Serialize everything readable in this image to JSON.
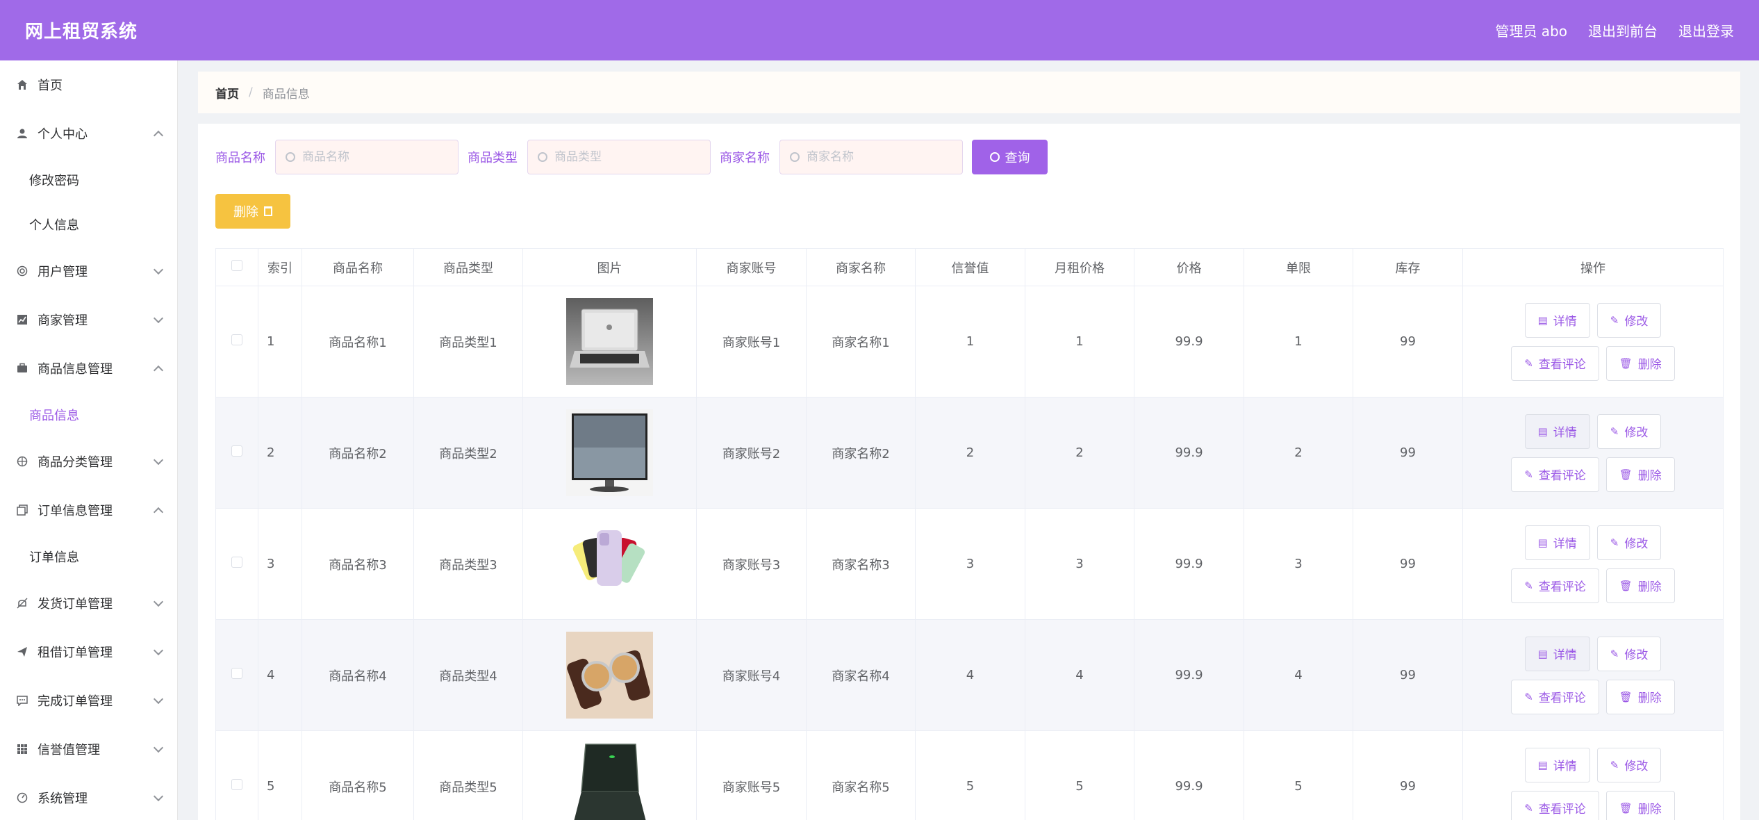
{
  "app": {
    "title": "网上租贸系统"
  },
  "header": {
    "user": "管理员 abo",
    "front": "退出到前台",
    "logout": "退出登录"
  },
  "sidebar": {
    "items": [
      {
        "label": "首页",
        "icon": "home-icon"
      },
      {
        "label": "个人中心",
        "icon": "user-icon",
        "sub": [
          "修改密码",
          "个人信息"
        ]
      },
      {
        "label": "用户管理",
        "icon": "users-icon"
      },
      {
        "label": "商家管理",
        "icon": "chart-icon"
      },
      {
        "label": "商品信息管理",
        "icon": "briefcase-icon",
        "sub": [
          "商品信息"
        ]
      },
      {
        "label": "商品分类管理",
        "icon": "compass-icon"
      },
      {
        "label": "订单信息管理",
        "icon": "copy-icon",
        "sub": [
          "订单信息"
        ]
      },
      {
        "label": "发货订单管理",
        "icon": "bell-icon"
      },
      {
        "label": "租借订单管理",
        "icon": "send-icon"
      },
      {
        "label": "完成订单管理",
        "icon": "chat-icon"
      },
      {
        "label": "信誉值管理",
        "icon": "grid-icon"
      },
      {
        "label": "系统管理",
        "icon": "settings-icon"
      }
    ]
  },
  "breadcrumb": {
    "home": "首页",
    "sep": "/",
    "current": "商品信息"
  },
  "search": {
    "name_label": "商品名称",
    "name_placeholder": "商品名称",
    "type_label": "商品类型",
    "type_placeholder": "商品类型",
    "merchant_label": "商家名称",
    "merchant_placeholder": "商家名称",
    "query": "查询"
  },
  "toolbar": {
    "delete": "删除"
  },
  "table": {
    "headers": [
      "索引",
      "商品名称",
      "商品类型",
      "图片",
      "商家账号",
      "商家名称",
      "信誉值",
      "月租价格",
      "价格",
      "单限",
      "库存",
      "操作"
    ],
    "ops": {
      "detail": "详情",
      "edit": "修改",
      "comments": "查看评论",
      "delete": "删除"
    },
    "rows": [
      {
        "index": "1",
        "name": "商品名称1",
        "type": "商品类型1",
        "image": "laptop",
        "account": "商家账号1",
        "merchant": "商家名称1",
        "credit": "1",
        "monthly": "1",
        "price": "99.9",
        "limit": "1",
        "stock": "99"
      },
      {
        "index": "2",
        "name": "商品名称2",
        "type": "商品类型2",
        "image": "monitor",
        "account": "商家账号2",
        "merchant": "商家名称2",
        "credit": "2",
        "monthly": "2",
        "price": "99.9",
        "limit": "2",
        "stock": "99"
      },
      {
        "index": "3",
        "name": "商品名称3",
        "type": "商品类型3",
        "image": "phone",
        "account": "商家账号3",
        "merchant": "商家名称3",
        "credit": "3",
        "monthly": "3",
        "price": "99.9",
        "limit": "3",
        "stock": "99"
      },
      {
        "index": "4",
        "name": "商品名称4",
        "type": "商品类型4",
        "image": "watch",
        "account": "商家账号4",
        "merchant": "商家名称4",
        "credit": "4",
        "monthly": "4",
        "price": "99.9",
        "limit": "4",
        "stock": "99"
      },
      {
        "index": "5",
        "name": "商品名称5",
        "type": "商品类型5",
        "image": "gaming-laptop",
        "account": "商家账号5",
        "merchant": "商家名称5",
        "credit": "5",
        "monthly": "5",
        "price": "99.9",
        "limit": "5",
        "stock": "99"
      }
    ]
  },
  "colors": {
    "primary": "#a06ae8",
    "accent": "#9b59e6",
    "warning": "#f6c340"
  }
}
